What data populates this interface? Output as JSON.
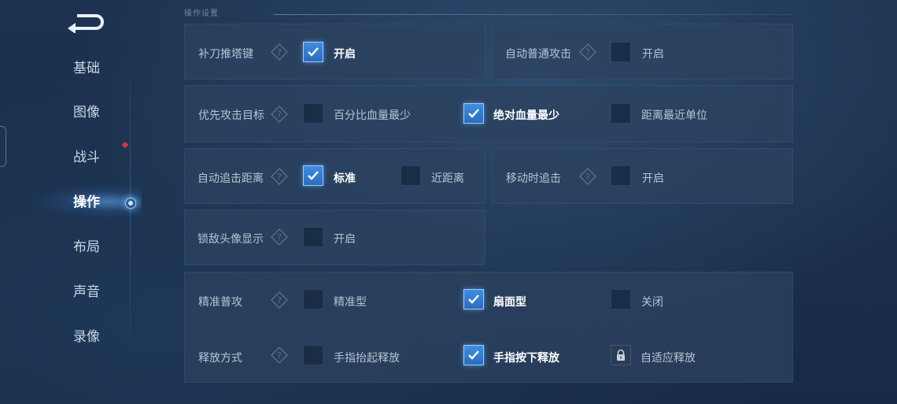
{
  "nav": {
    "items": [
      {
        "label": "基础"
      },
      {
        "label": "图像"
      },
      {
        "label": "战斗"
      },
      {
        "label": "操作"
      },
      {
        "label": "布局"
      },
      {
        "label": "声音"
      },
      {
        "label": "录像"
      }
    ],
    "active": "操作",
    "badge_item": "战斗"
  },
  "section": {
    "title": "操作设置"
  },
  "settings": {
    "last_hit": {
      "label": "补刀推塔键",
      "option": "开启",
      "checked": true
    },
    "auto_attack": {
      "label": "自动普通攻击",
      "option": "开启",
      "checked": false
    },
    "target_priority": {
      "label": "优先攻击目标",
      "options": [
        {
          "text": "百分比血量最少",
          "checked": false
        },
        {
          "text": "绝对血量最少",
          "checked": true
        },
        {
          "text": "距离最近单位",
          "checked": false
        }
      ]
    },
    "chase_distance": {
      "label": "自动追击距离",
      "options": [
        {
          "text": "标准",
          "checked": true
        },
        {
          "text": "近距离",
          "checked": false
        }
      ]
    },
    "move_chase": {
      "label": "移动时追击",
      "option": "开启",
      "checked": false
    },
    "lock_avatar": {
      "label": "锁敌头像显示",
      "option": "开启",
      "checked": false
    },
    "precise_attack": {
      "label": "精准普攻",
      "options": [
        {
          "text": "精准型",
          "checked": false
        },
        {
          "text": "扇面型",
          "checked": true
        },
        {
          "text": "关闭",
          "checked": false
        }
      ]
    },
    "release_mode": {
      "label": "释放方式",
      "options": [
        {
          "text": "手指抬起释放",
          "checked": false
        },
        {
          "text": "手指按下释放",
          "checked": true
        },
        {
          "text": "自适应释放",
          "locked": true
        }
      ]
    }
  },
  "colors": {
    "accent": "#3f8ee0",
    "badge": "#e0323d",
    "panel": "#2c4260"
  },
  "icons": {
    "back": "back-arrow-icon",
    "help": "help-diamond-icon",
    "check": "check-icon",
    "lock": "lock-icon"
  }
}
